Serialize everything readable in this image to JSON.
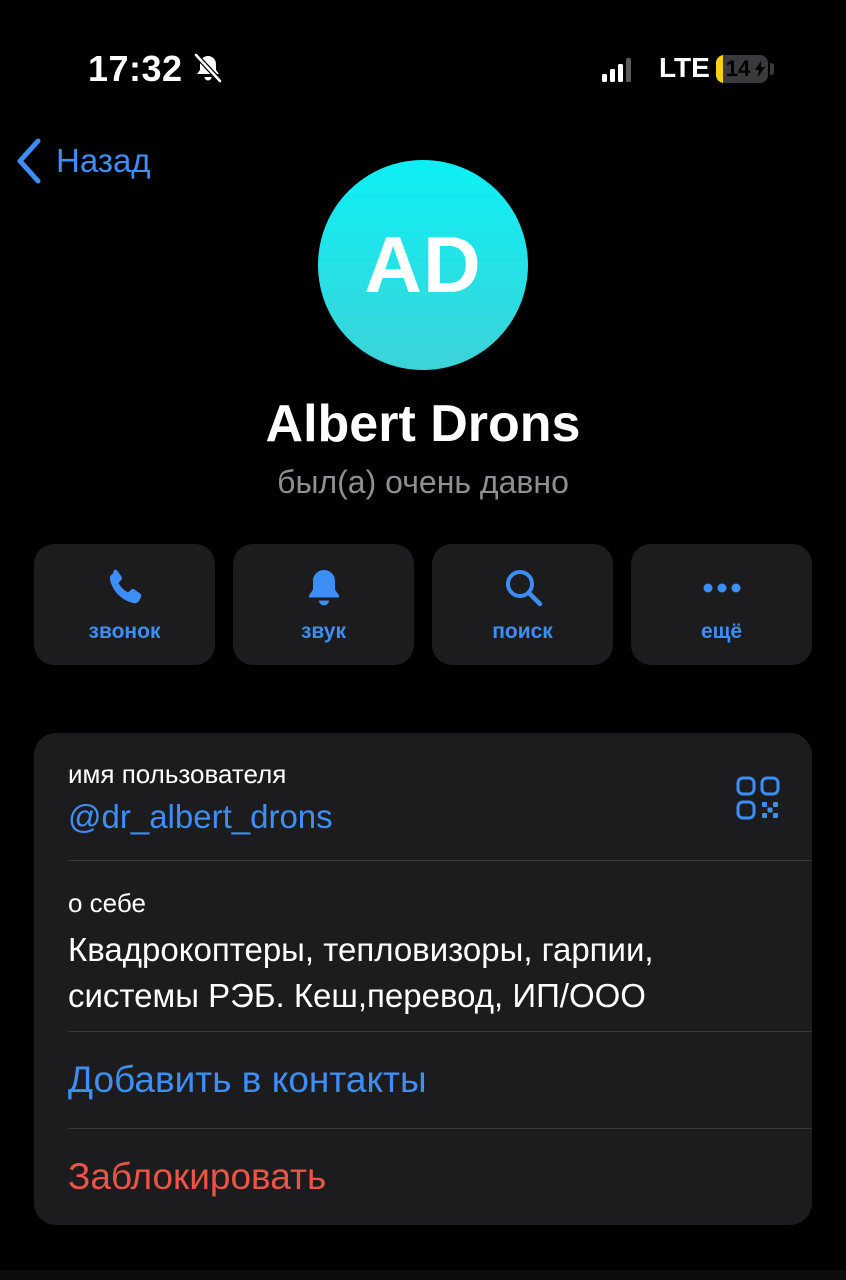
{
  "status_bar": {
    "time": "17:32",
    "network": "LTE",
    "battery_percent": 14,
    "battery_label": "14",
    "mute_icon": "bell-slash-icon",
    "signal_icon": "cellular-signal-icon"
  },
  "nav": {
    "back_label": "Назад",
    "back_icon": "chevron-left-icon"
  },
  "profile": {
    "initials": "AD",
    "name": "Albert Drons",
    "last_seen": "был(а) очень давно"
  },
  "actions": [
    {
      "label": "звонок",
      "icon": "phone-icon"
    },
    {
      "label": "звук",
      "icon": "bell-icon"
    },
    {
      "label": "поиск",
      "icon": "search-icon"
    },
    {
      "label": "ещё",
      "icon": "more-icon"
    }
  ],
  "info": {
    "username_label": "имя пользователя",
    "username": "@dr_albert_drons",
    "qr_icon": "qr-code-icon",
    "bio_label": "о себе",
    "bio": "Квадрокоптеры, тепловизоры, гарпии, системы РЭБ. Кеш,перевод, ИП/ООО",
    "add_contact": "Добавить в контакты",
    "block": "Заблокировать"
  },
  "colors": {
    "background": "#000000",
    "card": "#1c1c1e",
    "accent": "#3e8ef7",
    "danger": "#eb5545",
    "secondary_text": "#8e8e93",
    "avatar_top": "#0cf0f5",
    "avatar_bottom": "#3cd3d8",
    "battery": "#f5d11a"
  }
}
